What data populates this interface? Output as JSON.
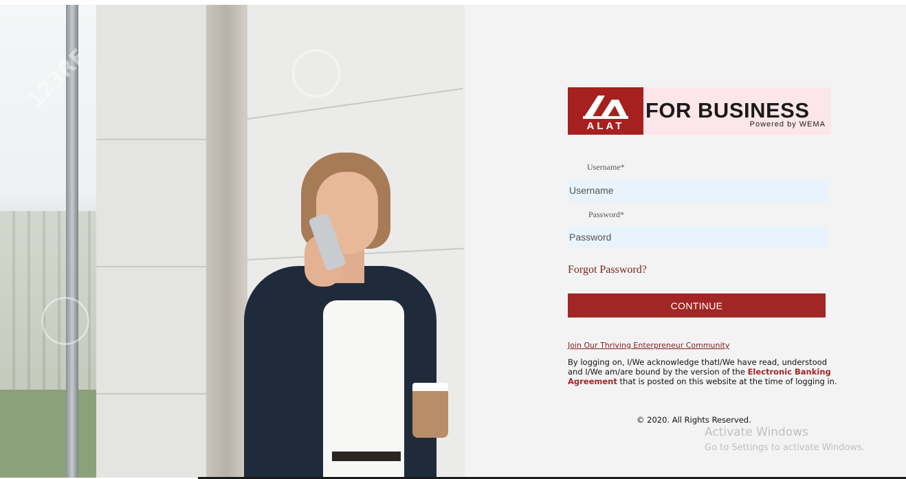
{
  "brand": {
    "mark_text": "ALAT",
    "title": "FOR BUSINESS",
    "tagline": "Powered by WEMA",
    "mark_color": "#a6201f",
    "title_bg": "#fce6ea"
  },
  "photo": {
    "watermark_text": "123RF"
  },
  "login": {
    "username_label": "Username*",
    "username_placeholder": "Username",
    "password_label": "Password*",
    "password_placeholder": "Password",
    "forgot_label": "Forgot Password?",
    "continue_label": "CONTINUE",
    "accent_color": "#a32626"
  },
  "footer": {
    "community_link": "Join Our Thriving Enterpreneur Community",
    "terms_prefix": "By logging on, I/We acknowledge thatI/We have read, understood and I/We am/are bound by the version of the ",
    "terms_link": "Electronic Banking Agreement",
    "terms_suffix": " that is posted on this website at the time of logging in.",
    "copyright": "© 2020. All Rights Reserved."
  },
  "os_overlay": {
    "activate_title": "Activate Windows",
    "activate_sub": "Go to Settings to activate Windows."
  }
}
